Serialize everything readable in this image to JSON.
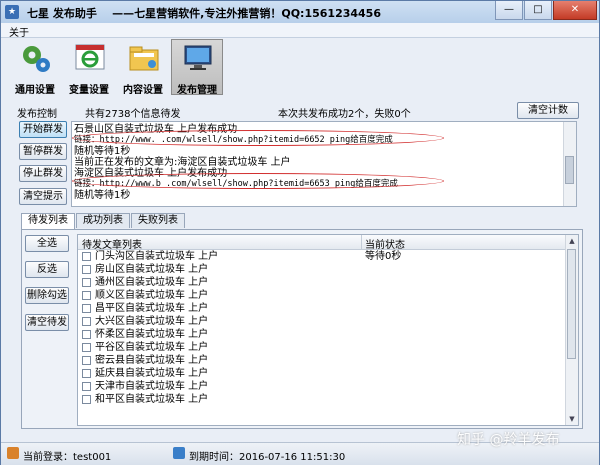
{
  "window": {
    "title": "七星        发布助手",
    "subtitle": "——七星营销软件,专注外推营销！QQ:1561234456",
    "minimize": "—",
    "maximize": "□",
    "close": "✕"
  },
  "menu": {
    "about": "关于"
  },
  "toolbar": [
    {
      "label": "通用设置",
      "icon": "gears-icon"
    },
    {
      "label": "变量设置",
      "icon": "ie-browser-icon"
    },
    {
      "label": "内容设置",
      "icon": "folder-icon"
    },
    {
      "label": "发布管理",
      "icon": "monitor-icon"
    }
  ],
  "control": {
    "group_label": "发布控制",
    "summary_pending": "共有2738个信息待发",
    "summary_result": "本次共发布成功2个，失败0个",
    "clear_count": "清空计数",
    "start": "开始群发",
    "pause": "暂停群发",
    "stop": "停止群发",
    "clear_tip": "清空提示"
  },
  "log": [
    "石景山区自装式垃圾车 上户发布成功",
    "链接：http://www.        .com/wlsell/show.php?itemid=6652    ping给百度完成",
    "随机等待1秒",
    "当前正在发布的文章为:海淀区自装式垃圾车 上户",
    "海淀区自装式垃圾车 上户发布成功",
    "链接：http://www.b       .com/wlsell/show.php?itemid=6653    ping给百度完成",
    "随机等待1秒"
  ],
  "tabs": [
    "待发列表",
    "成功列表",
    "失败列表"
  ],
  "list_buttons": {
    "select_all": "全选",
    "invert": "反选",
    "delete_checked": "删除勾选",
    "clear_pending": "清空待发"
  },
  "grid": {
    "col_title": "待发文章列表",
    "col_status": "当前状态",
    "rows": [
      {
        "title": "门头沟区自装式垃圾车 上户",
        "status": "等待0秒"
      },
      {
        "title": "房山区自装式垃圾车 上户",
        "status": ""
      },
      {
        "title": "通州区自装式垃圾车 上户",
        "status": ""
      },
      {
        "title": "顺义区自装式垃圾车 上户",
        "status": ""
      },
      {
        "title": "昌平区自装式垃圾车 上户",
        "status": ""
      },
      {
        "title": "大兴区自装式垃圾车 上户",
        "status": ""
      },
      {
        "title": "怀柔区自装式垃圾车 上户",
        "status": ""
      },
      {
        "title": "平谷区自装式垃圾车 上户",
        "status": ""
      },
      {
        "title": "密云县自装式垃圾车 上户",
        "status": ""
      },
      {
        "title": "延庆县自装式垃圾车 上户",
        "status": ""
      },
      {
        "title": "天津市自装式垃圾车 上户",
        "status": ""
      },
      {
        "title": "和平区自装式垃圾车 上户",
        "status": ""
      }
    ]
  },
  "status": {
    "login": "当前登录：test001",
    "expiry": "到期时间：2016-07-16 11:51:30"
  },
  "watermark": "知乎 @羚羊发布",
  "colors": {
    "accent": "#3a6fb5",
    "highlight": "#d23030"
  }
}
